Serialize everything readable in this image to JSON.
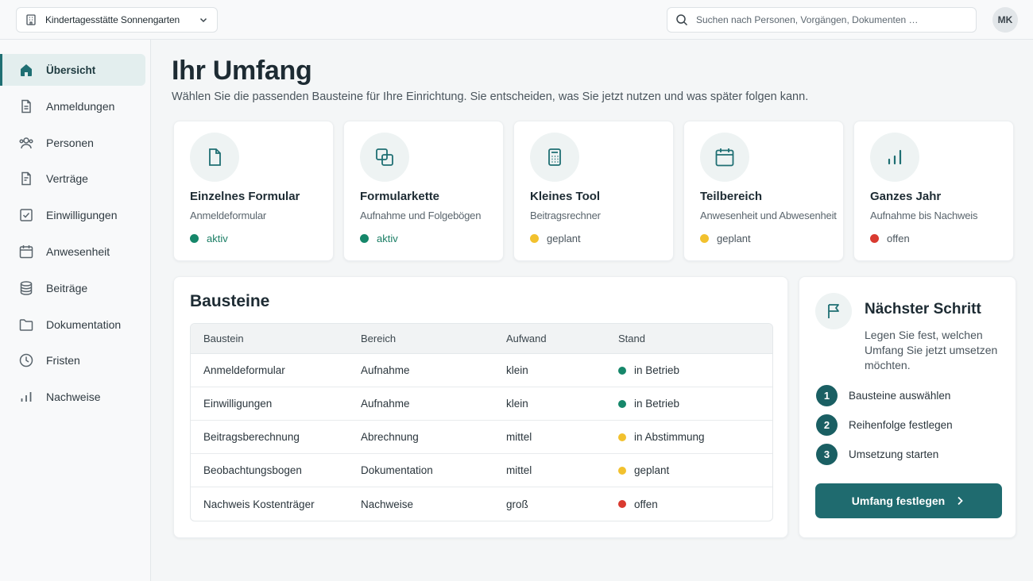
{
  "header": {
    "organization": "Kindertagesstätte Sonnengarten",
    "search_placeholder": "Suchen nach Personen, Vorgängen, Dokumenten …",
    "avatar_initials": "MK"
  },
  "sidebar": {
    "items": [
      {
        "label": "Übersicht",
        "icon": "home-icon",
        "active": true
      },
      {
        "label": "Anmeldungen",
        "icon": "document-icon"
      },
      {
        "label": "Personen",
        "icon": "users-icon"
      },
      {
        "label": "Verträge",
        "icon": "contract-icon"
      },
      {
        "label": "Einwilligungen",
        "icon": "checkbox-icon"
      },
      {
        "label": "Anwesenheit",
        "icon": "calendar-icon"
      },
      {
        "label": "Beiträge",
        "icon": "database-icon"
      },
      {
        "label": "Dokumentation",
        "icon": "folder-icon"
      },
      {
        "label": "Fristen",
        "icon": "clock-icon"
      },
      {
        "label": "Nachweise",
        "icon": "bar-chart-icon"
      }
    ]
  },
  "main": {
    "title": "Ihr Umfang",
    "subtitle": "Wählen Sie die passenden Bausteine für Ihre Einrichtung. Sie entscheiden, was Sie jetzt nutzen und was später folgen kann."
  },
  "cards": [
    {
      "title": "Einzelnes Formular",
      "subtitle": "Anmeldeformular",
      "status": "aktiv",
      "status_color": "#16876a",
      "icon": "file-icon"
    },
    {
      "title": "Formularkette",
      "subtitle": "Aufnahme und Folgebögen",
      "status": "aktiv",
      "status_color": "#16876a",
      "icon": "copy-icon"
    },
    {
      "title": "Kleines Tool",
      "subtitle": "Beitragsrechner",
      "status": "geplant",
      "status_color": "#f2c12e",
      "icon": "calculator-icon"
    },
    {
      "title": "Teilbereich",
      "subtitle": "Anwesenheit und Abwesenheit",
      "status": "geplant",
      "status_color": "#f2c12e",
      "icon": "calendar-icon"
    },
    {
      "title": "Ganzes Jahr",
      "subtitle": "Aufnahme bis Nachweis",
      "status": "offen",
      "status_color": "#d93a30",
      "icon": "bar-chart-icon"
    }
  ],
  "bausteine": {
    "title": "Bausteine",
    "columns": [
      "Baustein",
      "Bereich",
      "Aufwand",
      "Stand"
    ],
    "rows": [
      {
        "baustein": "Anmeldeformular",
        "bereich": "Aufnahme",
        "aufwand": "klein",
        "stand": "in Betrieb",
        "stand_color": "#16876a"
      },
      {
        "baustein": "Einwilligungen",
        "bereich": "Aufnahme",
        "aufwand": "klein",
        "stand": "in Betrieb",
        "stand_color": "#16876a"
      },
      {
        "baustein": "Beitragsberechnung",
        "bereich": "Abrechnung",
        "aufwand": "mittel",
        "stand": "in Abstimmung",
        "stand_color": "#f2c12e"
      },
      {
        "baustein": "Beobachtungsbogen",
        "bereich": "Dokumentation",
        "aufwand": "mittel",
        "stand": "geplant",
        "stand_color": "#f2c12e"
      },
      {
        "baustein": "Nachweis Kostenträger",
        "bereich": "Nachweise",
        "aufwand": "groß",
        "stand": "offen",
        "stand_color": "#d93a30"
      }
    ]
  },
  "next_step": {
    "title": "Nächster Schritt",
    "description": "Legen Sie fest, welchen Umfang Sie jetzt umsetzen möchten.",
    "steps": [
      {
        "number": "1",
        "label": "Bausteine auswählen"
      },
      {
        "number": "2",
        "label": "Reihenfolge festlegen"
      },
      {
        "number": "3",
        "label": "Umsetzung starten"
      }
    ],
    "button_label": "Umfang festlegen"
  },
  "colors": {
    "accent": "#1f6f73",
    "button": "#1f6b6f",
    "status_active": "#16876a",
    "status_planned": "#f2c12e",
    "status_open": "#d93a30"
  }
}
